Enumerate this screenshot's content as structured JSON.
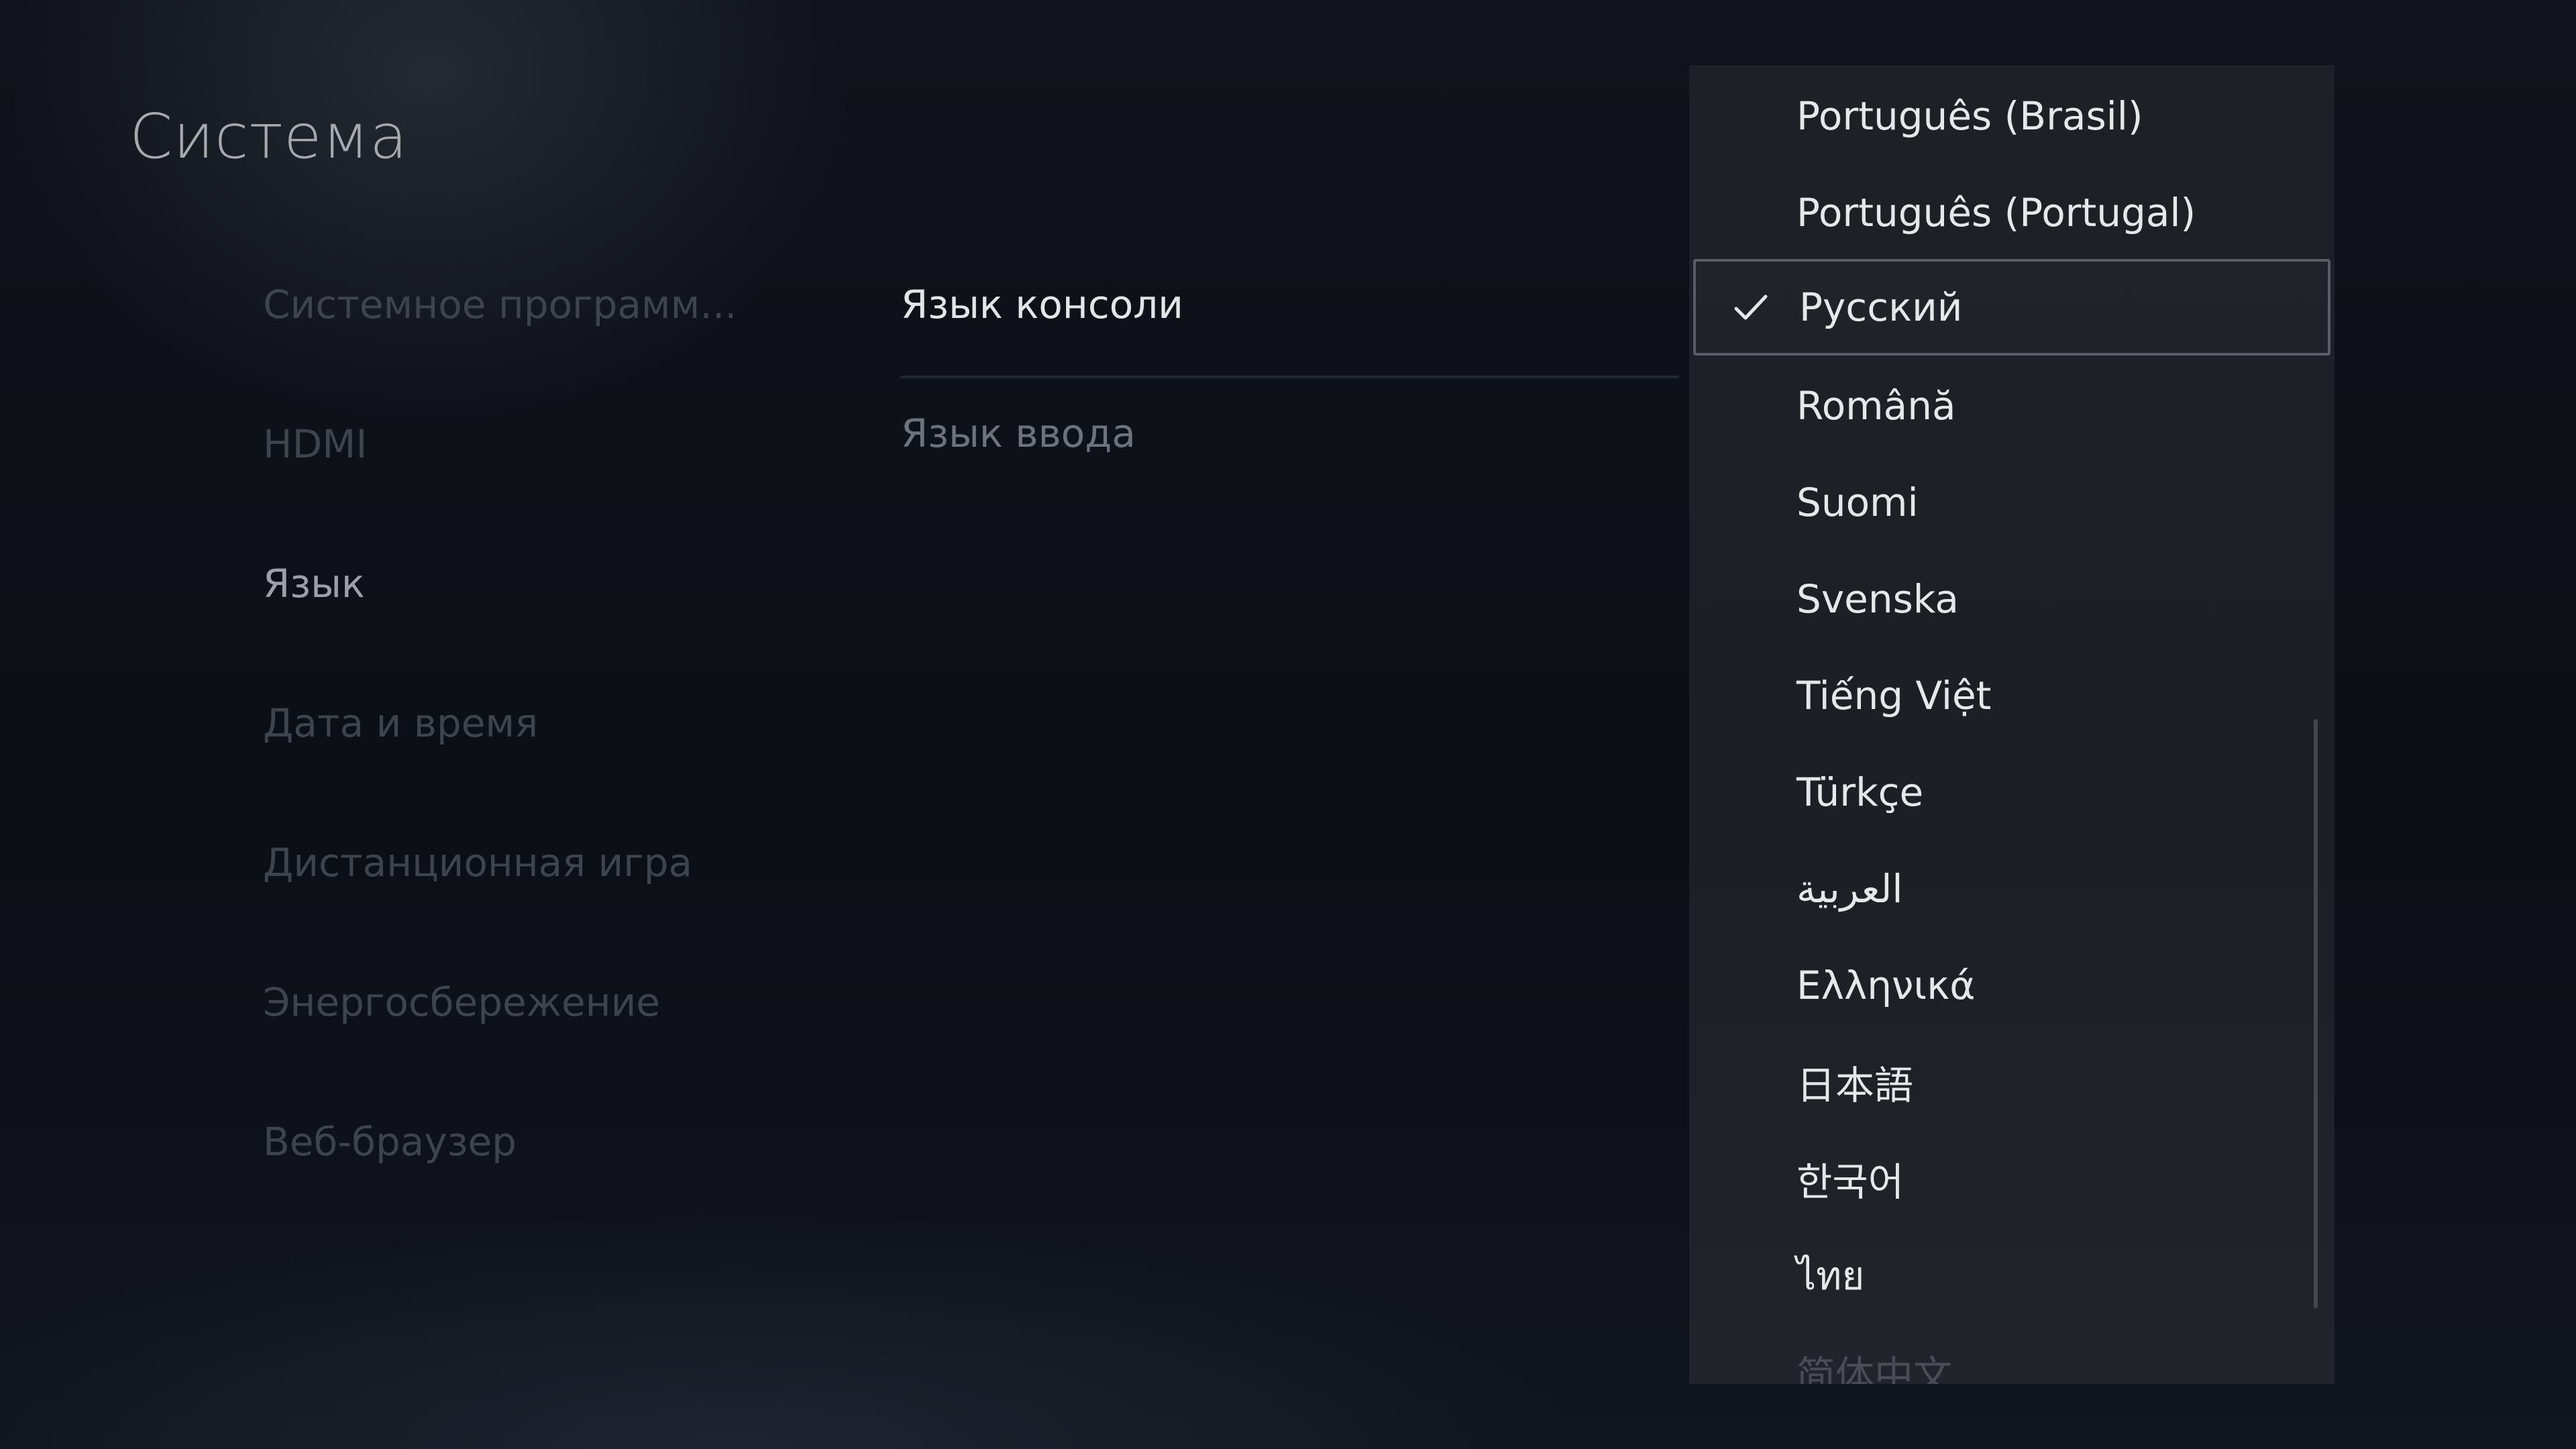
{
  "page": {
    "title": "Система"
  },
  "sidebar": {
    "items": [
      {
        "label": "Системное программ..."
      },
      {
        "label": "HDMI"
      },
      {
        "label": "Язык"
      },
      {
        "label": "Дата и время"
      },
      {
        "label": "Дистанционная игра"
      },
      {
        "label": "Энергосбережение"
      },
      {
        "label": "Веб-браузер"
      }
    ],
    "active_index": 2
  },
  "settings": {
    "console_language_label": "Язык консоли",
    "input_language_label": "Язык ввода"
  },
  "language_dropdown": {
    "selected": "Русский",
    "check_icon": "checkmark-icon",
    "options": [
      {
        "label": "Português (Brasil)"
      },
      {
        "label": "Português (Portugal)"
      },
      {
        "label": "Русский"
      },
      {
        "label": "Română"
      },
      {
        "label": "Suomi"
      },
      {
        "label": "Svenska"
      },
      {
        "label": "Tiếng Việt"
      },
      {
        "label": "Türkçe"
      },
      {
        "label": "العربية"
      },
      {
        "label": "Ελληνικά"
      },
      {
        "label": "日本語"
      },
      {
        "label": "한국어"
      },
      {
        "label": "ไทย"
      },
      {
        "label": "简体中文"
      }
    ]
  },
  "colors": {
    "background": "#0b0d12",
    "panel": "#1e2026",
    "text_primary": "#e6e7e9",
    "text_dim": "#3f434a",
    "selection_border": "#5a5d64"
  }
}
